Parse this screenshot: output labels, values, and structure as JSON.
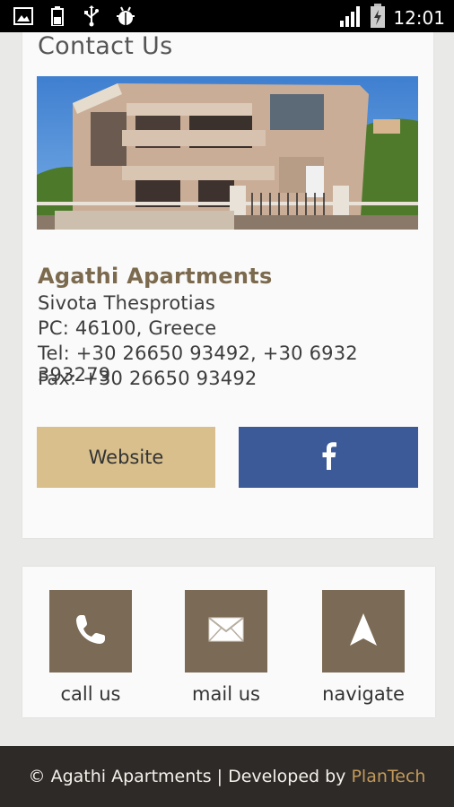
{
  "status_bar": {
    "time": "12:01",
    "icons": [
      "image-icon",
      "battery-small-icon",
      "usb-icon",
      "android-debug-icon",
      "signal-icon",
      "battery-icon"
    ]
  },
  "page": {
    "title": "Contact Us"
  },
  "business": {
    "name": "Agathi Apartments",
    "lines": [
      "Sivota Thesprotias",
      "PC: 46100, Greece",
      "Tel: +30 26650 93492, +30 6932 393279",
      "Fax: +30 26650 93492"
    ]
  },
  "buttons": {
    "website": "Website",
    "facebook_icon": "facebook-icon"
  },
  "actions": [
    {
      "label": "call us",
      "icon": "phone-icon"
    },
    {
      "label": "mail us",
      "icon": "mail-icon"
    },
    {
      "label": "navigate",
      "icon": "navigate-arrow-icon"
    }
  ],
  "footer": {
    "prefix": "© Agathi Apartments | Developed by ",
    "brand": "PlanTech"
  },
  "colors": {
    "accent_brown": "#7b6a55",
    "website_button": "#d8bf8c",
    "facebook_blue": "#3d5a98",
    "footer_bg": "#2d2a28",
    "footer_brand": "#c29a5a"
  }
}
